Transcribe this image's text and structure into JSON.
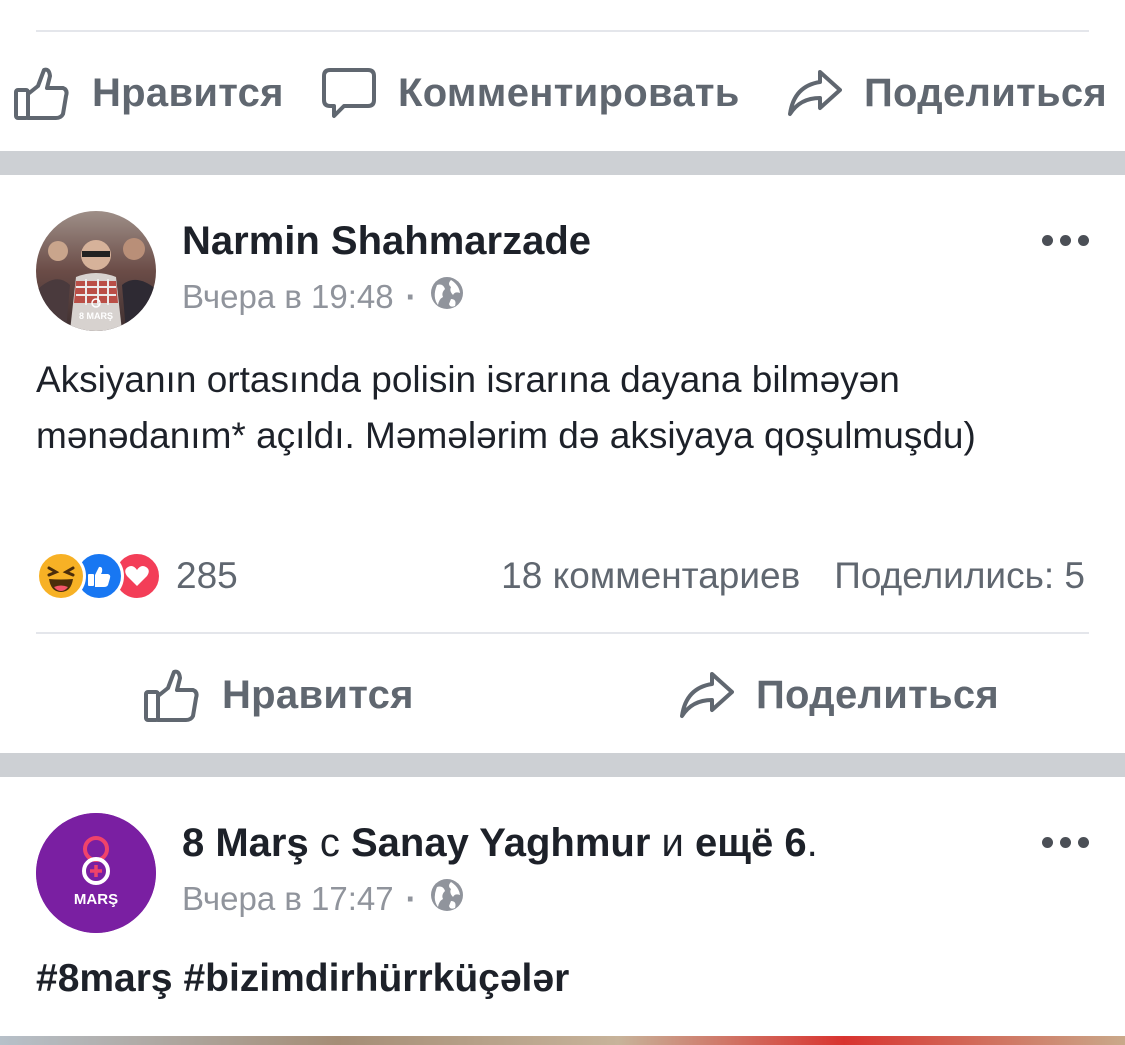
{
  "top_actions": {
    "like_label": "Нравится",
    "comment_label": "Комментировать",
    "share_label": "Поделиться"
  },
  "post1": {
    "author": "Narmin Shahmarzade",
    "time": "Вчера в 19:48",
    "avatar_badge": "8 MARŞ",
    "text": "Aksiyanın ortasında polisin israrına dayana bilməyən mənədanım* açıldı. Məmələrim də aksiyaya qoşulmuşdu)",
    "reaction_count": "285",
    "comments": "18 комментариев",
    "shares": "Поделились: 5",
    "like_label": "Нравится",
    "share_label": "Поделиться"
  },
  "post2": {
    "author_page": "8 Marş",
    "with_word": "с",
    "tagged": "Sanay Yaghmur",
    "and_word": "и",
    "others": "ещё 6",
    "time": "Вчера в 17:47",
    "avatar_label": "MARŞ",
    "hashtags": "#8marş #bizimdirhürrküçələr"
  },
  "icons": [
    "thumbs-up-icon",
    "comment-bubble-icon",
    "share-arrow-icon",
    "globe-icon",
    "more-dots-icon",
    "haha-reaction-icon",
    "like-reaction-icon",
    "love-reaction-icon"
  ],
  "colors": {
    "action_text": "#606770",
    "meta_text": "#90949c",
    "divider_band": "#cdd0d4",
    "brand_purple": "#7a1fa2",
    "like_blue": "#1877f2",
    "love_red": "#f33e58",
    "haha_yellow": "#f7b125"
  }
}
